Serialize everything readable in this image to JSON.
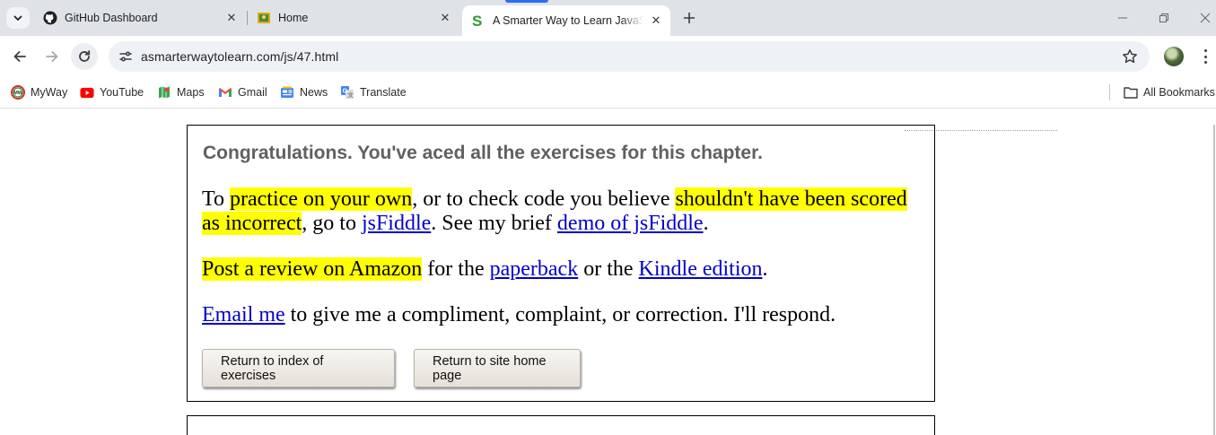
{
  "browser": {
    "tabs": [
      {
        "title": "GitHub Dashboard",
        "icon": "github-icon",
        "active": false
      },
      {
        "title": "Home",
        "icon": "home-favicon",
        "active": false
      },
      {
        "title": "A Smarter Way to Learn JavaScript",
        "icon": "smarter-way-s-icon",
        "active": true
      }
    ],
    "url": "asmarterwaytolearn.com/js/47.html",
    "bookmarks": [
      {
        "label": "MyWay",
        "icon": "myway-icon"
      },
      {
        "label": "YouTube",
        "icon": "youtube-icon"
      },
      {
        "label": "Maps",
        "icon": "maps-icon"
      },
      {
        "label": "Gmail",
        "icon": "gmail-icon"
      },
      {
        "label": "News",
        "icon": "news-icon"
      },
      {
        "label": "Translate",
        "icon": "translate-icon"
      }
    ],
    "all_bookmarks": "All Bookmarks"
  },
  "content": {
    "heading": "Congratulations. You've aced all the exercises for this chapter.",
    "p1": {
      "t1": "To ",
      "h1": "practice on your own",
      "t2": ", or to check code you believe ",
      "h2": "shouldn't have been scored as incorrect",
      "t3": ", go to ",
      "link1": "jsFiddle",
      "t4": ". See my brief ",
      "link2": "demo of jsFiddle",
      "t5": "."
    },
    "p2": {
      "h1": "Post a review on Amazon",
      "t1": " for the ",
      "link1": "paperback",
      "t2": " or the ",
      "link2": "Kindle edition",
      "t3": "."
    },
    "p3": {
      "link1": "Email me",
      "t1": " to give me a compliment, complaint, or correction. I'll respond."
    },
    "buttons": {
      "index": "Return to index of exercises",
      "home": "Return to site home page"
    }
  },
  "colors": {
    "highlight": "#ffff00",
    "link": "#0000cc",
    "heading": "#606060",
    "tabstrip": "#dfe3e8"
  }
}
